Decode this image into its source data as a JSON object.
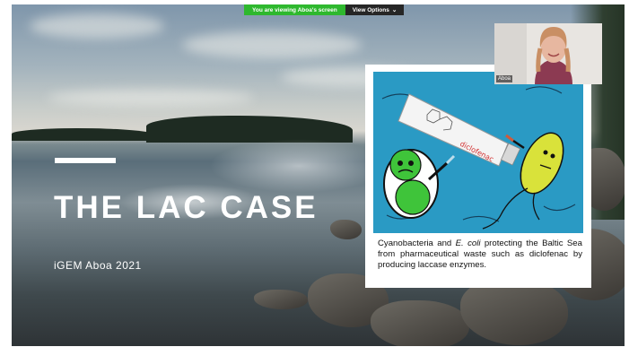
{
  "share_banner": {
    "viewing_text": "You are viewing Aboa's screen",
    "view_options_label": "View Options",
    "chevron_glyph": "⌄"
  },
  "slide": {
    "title": "THE LAC CASE",
    "subtitle": "iGEM Aboa 2021",
    "card": {
      "tube_label": "diclofenac",
      "caption_part1": "Cyanobacteria and ",
      "caption_italic": "E. coli",
      "caption_part2": " protecting the Baltic Sea from pharmaceutical waste such as diclofenac by producing laccase enzymes."
    }
  },
  "participant_video": {
    "name": "Aboa"
  },
  "colors": {
    "banner_green": "#2eb82e",
    "banner_dark": "#262626",
    "card_water": "#2a9ac4",
    "cell_green": "#3fc43a",
    "ecoli_yellow": "#d9e23a"
  }
}
